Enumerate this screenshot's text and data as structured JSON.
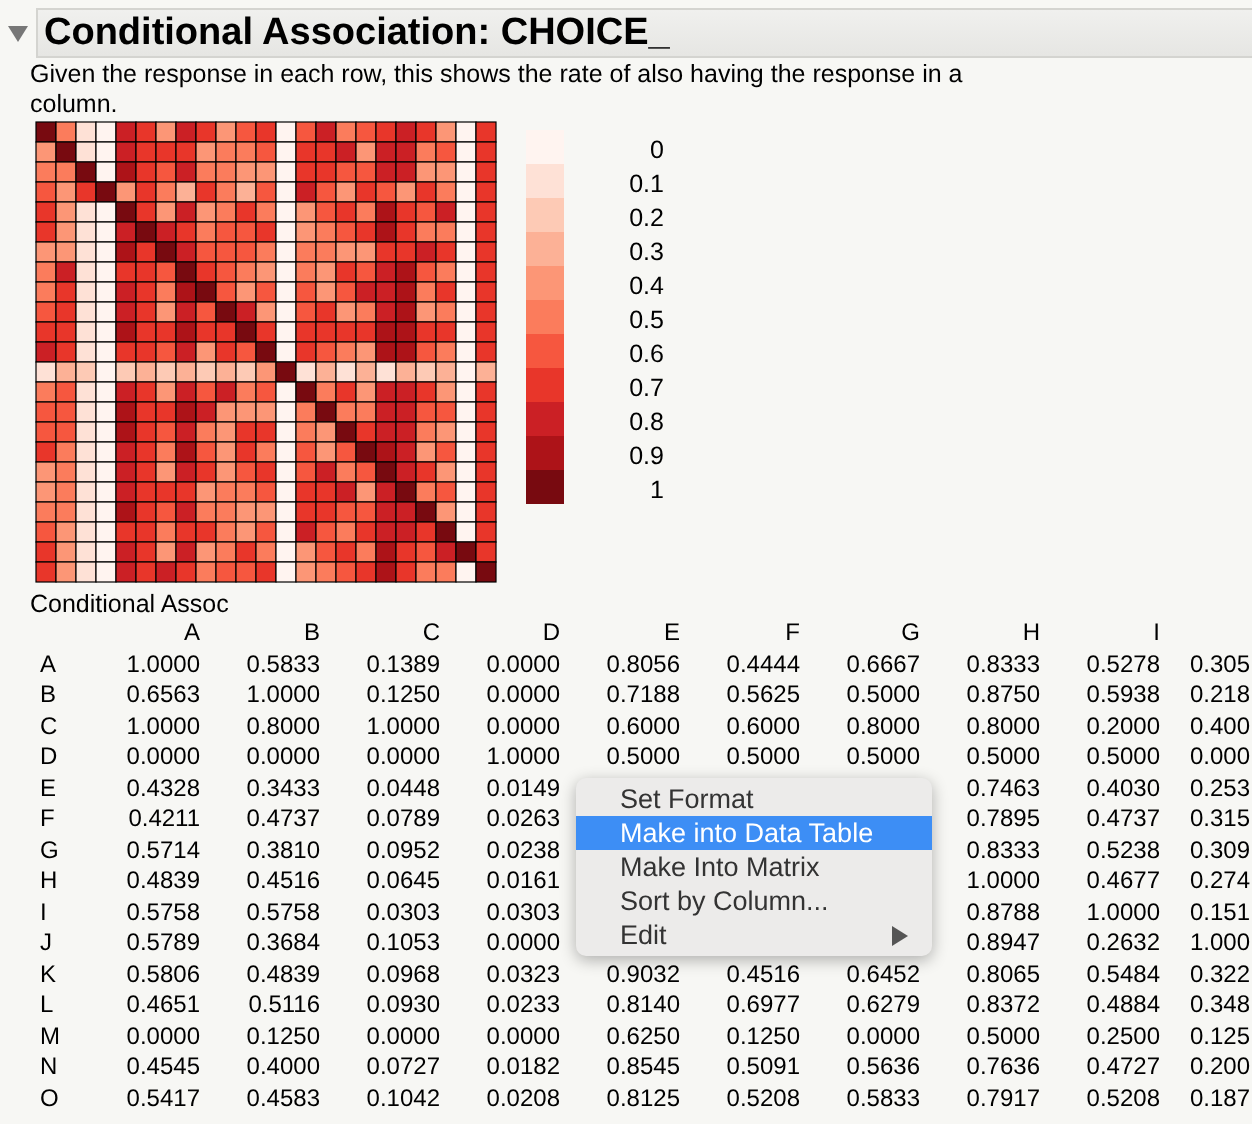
{
  "section": {
    "title": "Conditional Association: CHOICE_",
    "expanded": true,
    "description": "Given the response in each row, this shows the rate of also having the response in a column."
  },
  "legend": [
    {
      "label": "0",
      "color": "#fff4f0"
    },
    {
      "label": "0.1",
      "color": "#fee1d6"
    },
    {
      "label": "0.2",
      "color": "#fdcab5"
    },
    {
      "label": "0.3",
      "color": "#fcb196"
    },
    {
      "label": "0.4",
      "color": "#fc9676"
    },
    {
      "label": "0.5",
      "color": "#fb7c5c"
    },
    {
      "label": "0.6",
      "color": "#f6573f"
    },
    {
      "label": "0.7",
      "color": "#e8362a"
    },
    {
      "label": "0.8",
      "color": "#cb2025"
    },
    {
      "label": "0.9",
      "color": "#ad1318"
    },
    {
      "label": "1",
      "color": "#780a10"
    }
  ],
  "table": {
    "title": "Conditional Assoc",
    "columns": [
      "A",
      "B",
      "C",
      "D",
      "E",
      "F",
      "G",
      "H",
      "I"
    ],
    "rows": [
      {
        "label": "A",
        "cells": [
          "1.0000",
          "0.5833",
          "0.1389",
          "0.0000",
          "0.8056",
          "0.4444",
          "0.6667",
          "0.8333",
          "0.5278",
          "0.305"
        ]
      },
      {
        "label": "B",
        "cells": [
          "0.6563",
          "1.0000",
          "0.1250",
          "0.0000",
          "0.7188",
          "0.5625",
          "0.5000",
          "0.8750",
          "0.5938",
          "0.218"
        ]
      },
      {
        "label": "C",
        "cells": [
          "1.0000",
          "0.8000",
          "1.0000",
          "0.0000",
          "0.6000",
          "0.6000",
          "0.8000",
          "0.8000",
          "0.2000",
          "0.400"
        ]
      },
      {
        "label": "D",
        "cells": [
          "0.0000",
          "0.0000",
          "0.0000",
          "1.0000",
          "0.5000",
          "0.5000",
          "0.5000",
          "0.5000",
          "0.5000",
          "0.000"
        ]
      },
      {
        "label": "E",
        "cells": [
          "0.4328",
          "0.3433",
          "0.0448",
          "0.0149",
          null,
          null,
          null,
          "0.7463",
          "0.4030",
          "0.253"
        ]
      },
      {
        "label": "F",
        "cells": [
          "0.4211",
          "0.4737",
          "0.0789",
          "0.0263",
          null,
          null,
          null,
          "0.7895",
          "0.4737",
          "0.315"
        ]
      },
      {
        "label": "G",
        "cells": [
          "0.5714",
          "0.3810",
          "0.0952",
          "0.0238",
          null,
          null,
          null,
          "0.8333",
          "0.5238",
          "0.309"
        ]
      },
      {
        "label": "H",
        "cells": [
          "0.4839",
          "0.4516",
          "0.0645",
          "0.0161",
          null,
          null,
          null,
          "1.0000",
          "0.4677",
          "0.274"
        ]
      },
      {
        "label": "I",
        "cells": [
          "0.5758",
          "0.5758",
          "0.0303",
          "0.0303",
          null,
          null,
          null,
          "0.8788",
          "1.0000",
          "0.151"
        ]
      },
      {
        "label": "J",
        "cells": [
          "0.5789",
          "0.3684",
          "0.1053",
          "0.0000",
          null,
          null,
          null,
          "0.8947",
          "0.2632",
          "1.000"
        ]
      },
      {
        "label": "K",
        "cells": [
          "0.5806",
          "0.4839",
          "0.0968",
          "0.0323",
          "0.9032",
          "0.4516",
          "0.6452",
          "0.8065",
          "0.5484",
          "0.322"
        ]
      },
      {
        "label": "L",
        "cells": [
          "0.4651",
          "0.5116",
          "0.0930",
          "0.0233",
          "0.8140",
          "0.6977",
          "0.6279",
          "0.8372",
          "0.4884",
          "0.348"
        ]
      },
      {
        "label": "M",
        "cells": [
          "0.0000",
          "0.1250",
          "0.0000",
          "0.0000",
          "0.6250",
          "0.1250",
          "0.0000",
          "0.5000",
          "0.2500",
          "0.125"
        ]
      },
      {
        "label": "N",
        "cells": [
          "0.4545",
          "0.4000",
          "0.0727",
          "0.0182",
          "0.8545",
          "0.5091",
          "0.5636",
          "0.7636",
          "0.4727",
          "0.200"
        ]
      },
      {
        "label": "O",
        "cells": [
          "0.5417",
          "0.4583",
          "0.1042",
          "0.0208",
          "0.8125",
          "0.5208",
          "0.5833",
          "0.7917",
          "0.5208",
          "0.187"
        ]
      }
    ]
  },
  "context_menu": {
    "items": [
      {
        "label": "Set Format",
        "selected": false,
        "has_submenu": false
      },
      {
        "label": "Make into Data Table",
        "selected": true,
        "has_submenu": false
      },
      {
        "label": "Make Into Matrix",
        "selected": false,
        "has_submenu": false
      },
      {
        "label": "Sort by Column...",
        "selected": false,
        "has_submenu": false
      },
      {
        "label": "Edit",
        "selected": false,
        "has_submenu": true
      }
    ]
  }
}
